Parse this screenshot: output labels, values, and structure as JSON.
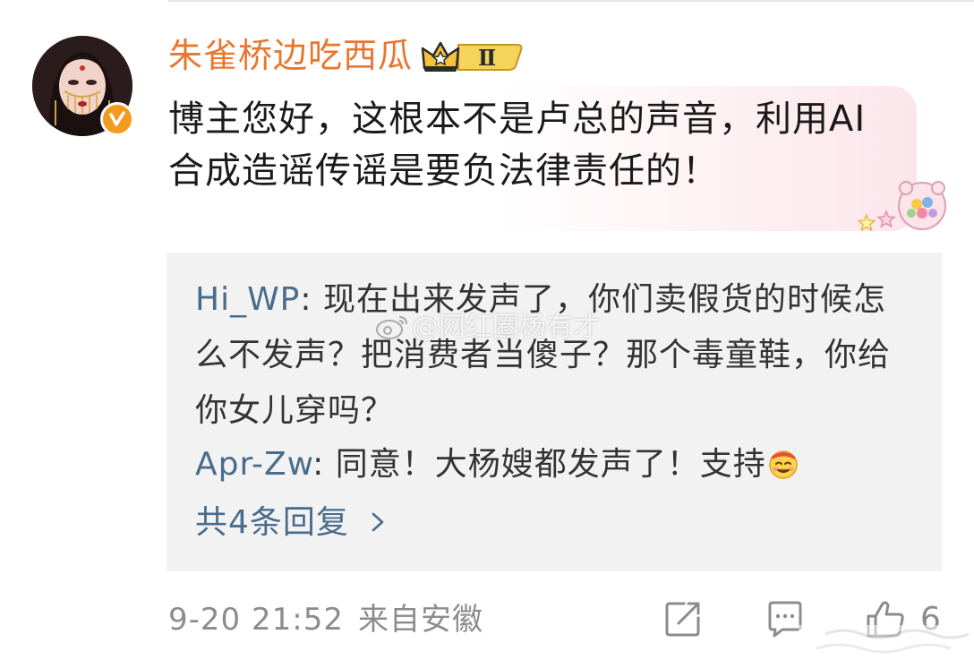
{
  "comment": {
    "username": "朱雀桥边吃西瓜",
    "level_badge": "Ⅱ",
    "text": "博主您好，这根本不是卢总的声音，利用AI合成造谣传谣是要负法律责任的！",
    "avatar_icon": "avatar-woman-icon",
    "verified_icon": "verified-v-icon",
    "accent_color": "#e8772e"
  },
  "replies": [
    {
      "author": "Hi_WP",
      "separator": ": ",
      "text": "现在出来发声了，你们卖假货的时候怎么不发声？把消费者当傻子？那个毒童鞋，你给你女儿穿吗？"
    },
    {
      "author": "Apr-Zw",
      "separator": ": ",
      "text": "同意！大杨嫂都发声了！支持",
      "emoji": "cheer-face-emoji"
    }
  ],
  "more_replies_label": "共4条回复",
  "watermark": "@网红圈杨有才",
  "meta": {
    "timestamp": "9-20 21:52",
    "source": "来自安徽"
  },
  "actions": {
    "like_count": "6"
  },
  "colors": {
    "reply_author": "#4a6c8c",
    "reply_bg": "#f2f2f2",
    "meta_text": "#8c8c8c"
  }
}
